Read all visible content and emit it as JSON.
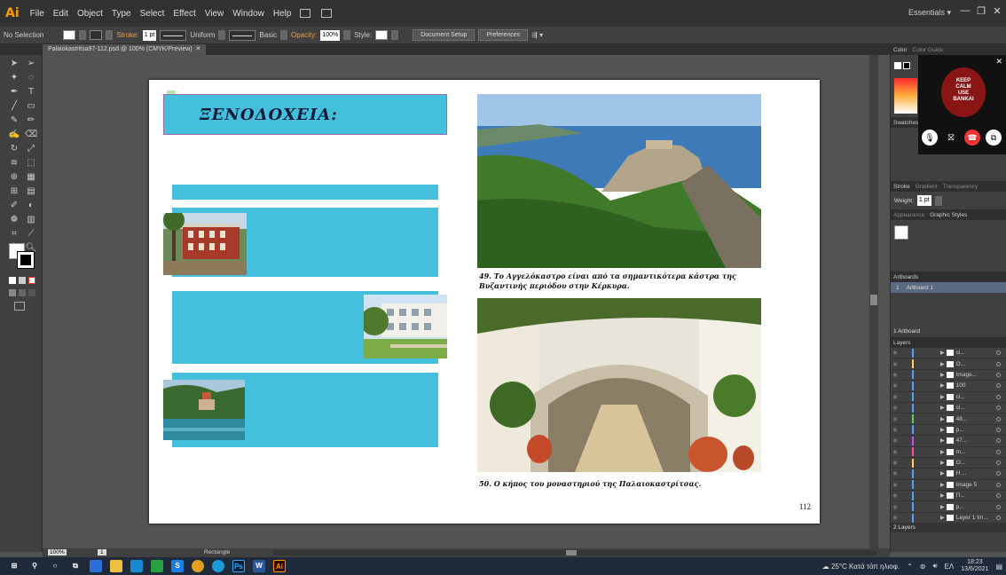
{
  "app": {
    "logo": "Ai",
    "menu": [
      "File",
      "Edit",
      "Object",
      "Type",
      "Select",
      "Effect",
      "View",
      "Window",
      "Help"
    ],
    "workspace": "Essentials"
  },
  "control_bar": {
    "selection": "No Selection",
    "stroke_label": "Stroke:",
    "stroke_weight": "1 pt",
    "profile": "Uniform",
    "brush": "Basic",
    "opacity_label": "Opacity:",
    "opacity": "100%",
    "style_label": "Style:",
    "document_setup": "Document Setup",
    "preferences": "Preferences"
  },
  "document": {
    "tab": "Palaiokastritsa97-112.psd @ 100% (CMYK/Preview)",
    "heading": "ΞΕΝΟΔΟΧΕΙΑ:",
    "caption_1": "49. Το Αγγελόκαστρο είναι από τα σημαντικότερα κάστρα της Βυζαντινής περιόδου στην Κέρκυρα.",
    "caption_2": "50. Ο κήπος του μοναστηριού της Παλαιοκαστρίτσας.",
    "page_number": "112"
  },
  "panels": {
    "color_tab": "Color",
    "color_guide_tab": "Color Guide",
    "swatches_tab": "Swatches",
    "stroke_tab": "Stroke",
    "gradient_tab": "Gradient",
    "transparency_tab": "Transparency",
    "weight_label": "Weight:",
    "weight_value": "1 pt",
    "appearance_tab": "Appearance",
    "graphic_styles_tab": "Graphic Styles",
    "artboards_tab": "Artboards",
    "artboard_index": "1",
    "artboard_name": "Artboard 1",
    "artboard_count": "1 Artboard",
    "layers_tab": "Layers",
    "layers": [
      {
        "name": "ci...",
        "color": "#4fa0ff"
      },
      {
        "name": "O...",
        "color": "#ffd24a"
      },
      {
        "name": "Image...",
        "color": "#4fa0ff"
      },
      {
        "name": "100",
        "color": "#4fa0ff"
      },
      {
        "name": "ci...",
        "color": "#4fa0ff"
      },
      {
        "name": "ci...",
        "color": "#4fa0ff"
      },
      {
        "name": "48...",
        "color": "#55d055"
      },
      {
        "name": "p...",
        "color": "#4fa0ff"
      },
      {
        "name": "47...",
        "color": "#c050ff"
      },
      {
        "name": "m...",
        "color": "#ff50a0"
      },
      {
        "name": "O...",
        "color": "#ffd24a"
      },
      {
        "name": "H ...",
        "color": "#4fa0ff"
      },
      {
        "name": "Image 5",
        "color": "#4fa0ff"
      },
      {
        "name": "Π...",
        "color": "#4fa0ff"
      },
      {
        "name": "p...",
        "color": "#4fa0ff"
      },
      {
        "name": "Layer 1 Im...",
        "color": "#4fa0ff"
      }
    ],
    "layers_count": "2 Layers"
  },
  "call": {
    "poster_line1": "KEEP",
    "poster_line2": "CALM",
    "poster_line3": "USE",
    "poster_line4": "BANKAI"
  },
  "status_bar": {
    "zoom": "100%",
    "artboard": "1",
    "tool": "Rectangle"
  },
  "taskbar": {
    "weather": "25°C  Κατά τόπ ηλιοφ.",
    "lang": "ΕΛ",
    "time": "18:23",
    "date": "13/6/2021"
  }
}
